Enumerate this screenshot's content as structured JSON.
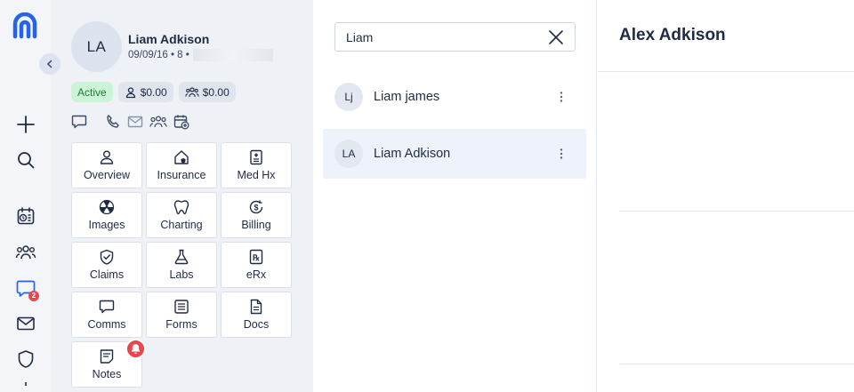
{
  "nav": {
    "badge_count": "2",
    "items": [
      {
        "name": "add-icon"
      },
      {
        "name": "search-icon"
      },
      {
        "name": "schedule-icon"
      },
      {
        "name": "patients-icon"
      },
      {
        "name": "messages-icon",
        "active": true
      },
      {
        "name": "mail-icon"
      },
      {
        "name": "shield-icon"
      }
    ],
    "accent": "#2563eb"
  },
  "patient": {
    "initials": "LA",
    "name": "Liam Adkison",
    "meta": "09/09/16 • 8 •",
    "status": "Active",
    "patient_balance": "$0.00",
    "family_balance": "$0.00",
    "tiles": [
      {
        "label": "Overview",
        "icon": "user-icon"
      },
      {
        "label": "Insurance",
        "icon": "insurance-icon"
      },
      {
        "label": "Med Hx",
        "icon": "med-history-icon"
      },
      {
        "label": "Images",
        "icon": "radiation-icon"
      },
      {
        "label": "Charting",
        "icon": "tooth-icon"
      },
      {
        "label": "Billing",
        "icon": "billing-icon"
      },
      {
        "label": "Claims",
        "icon": "shield-check-icon"
      },
      {
        "label": "Labs",
        "icon": "flask-icon"
      },
      {
        "label": "eRx",
        "icon": "rx-icon"
      },
      {
        "label": "Comms",
        "icon": "chat-icon"
      },
      {
        "label": "Forms",
        "icon": "forms-icon"
      },
      {
        "label": "Docs",
        "icon": "document-icon"
      },
      {
        "label": "Notes",
        "icon": "notes-icon"
      }
    ]
  },
  "search": {
    "value": "Liam",
    "results": [
      {
        "initials": "Lj",
        "name": "Liam james",
        "selected": false
      },
      {
        "initials": "LA",
        "name": "Liam Adkison",
        "selected": true
      }
    ]
  },
  "conversation": {
    "title": "Alex Adkison"
  },
  "colors": {
    "active_chip_bg": "#cdf3d6",
    "active_chip_text": "#1e7a3a",
    "alert_red": "#e5484d"
  }
}
